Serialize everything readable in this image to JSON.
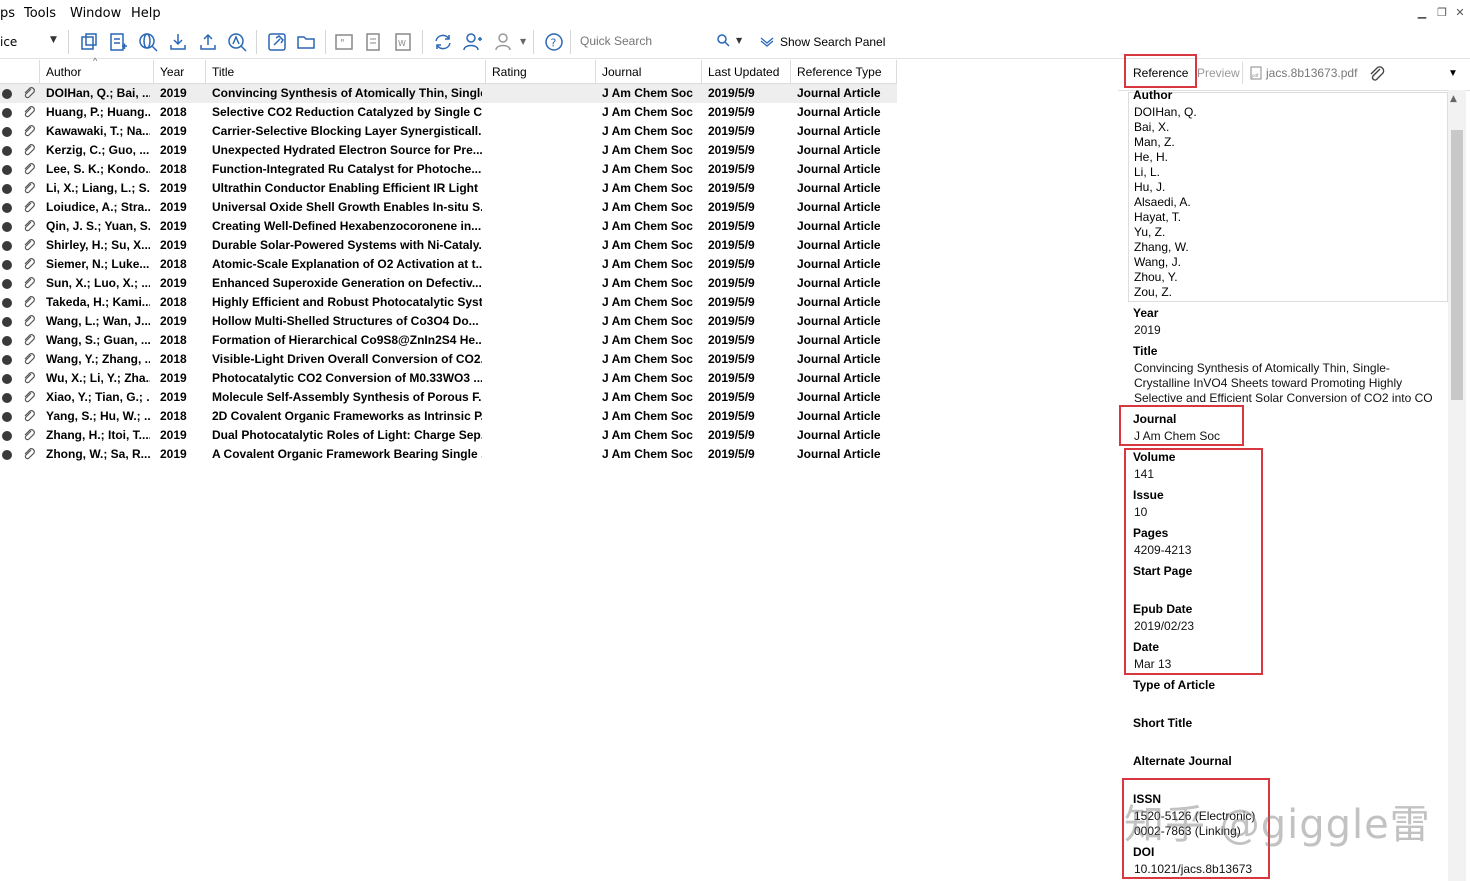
{
  "menu": {
    "partial": "ps",
    "tools": "Tools",
    "window": "Window",
    "help": "Help"
  },
  "toolbar": {
    "group_combo": "ice",
    "quick_search_placeholder": "Quick Search",
    "show_search_panel": "Show Search Panel"
  },
  "table": {
    "headers": [
      "Author",
      "Year",
      "Title",
      "Rating",
      "Journal",
      "Last Updated",
      "Reference Type"
    ],
    "rows": [
      {
        "author": "DOIHan, Q.; Bai, ...",
        "year": "2019",
        "title": "Convincing Synthesis of Atomically Thin, Single...",
        "journal": "J Am Chem Soc",
        "updated": "2019/5/9",
        "type": "Journal Article"
      },
      {
        "author": "Huang, P.; Huang...",
        "year": "2018",
        "title": "Selective CO2 Reduction Catalyzed by Single C...",
        "journal": "J Am Chem Soc",
        "updated": "2019/5/9",
        "type": "Journal Article"
      },
      {
        "author": "Kawawaki, T.; Na...",
        "year": "2019",
        "title": "Carrier-Selective Blocking Layer Synergisticall...",
        "journal": "J Am Chem Soc",
        "updated": "2019/5/9",
        "type": "Journal Article"
      },
      {
        "author": "Kerzig, C.; Guo, ...",
        "year": "2019",
        "title": "Unexpected Hydrated Electron Source for Pre...",
        "journal": "J Am Chem Soc",
        "updated": "2019/5/9",
        "type": "Journal Article"
      },
      {
        "author": "Lee, S. K.; Kondo...",
        "year": "2018",
        "title": "Function-Integrated Ru Catalyst for Photoche...",
        "journal": "J Am Chem Soc",
        "updated": "2019/5/9",
        "type": "Journal Article"
      },
      {
        "author": "Li, X.; Liang, L.; S...",
        "year": "2019",
        "title": "Ultrathin Conductor Enabling Efficient IR Light ...",
        "journal": "J Am Chem Soc",
        "updated": "2019/5/9",
        "type": "Journal Article"
      },
      {
        "author": "Loiudice, A.; Stra...",
        "year": "2019",
        "title": "Universal Oxide Shell Growth Enables In-situ S...",
        "journal": "J Am Chem Soc",
        "updated": "2019/5/9",
        "type": "Journal Article"
      },
      {
        "author": "Qin, J. S.; Yuan, S...",
        "year": "2019",
        "title": "Creating Well-Defined Hexabenzocoronene in...",
        "journal": "J Am Chem Soc",
        "updated": "2019/5/9",
        "type": "Journal Article"
      },
      {
        "author": "Shirley, H.; Su, X....",
        "year": "2019",
        "title": "Durable Solar-Powered Systems with Ni-Cataly...",
        "journal": "J Am Chem Soc",
        "updated": "2019/5/9",
        "type": "Journal Article"
      },
      {
        "author": "Siemer, N.; Luke...",
        "year": "2018",
        "title": "Atomic-Scale Explanation of O2 Activation at t...",
        "journal": "J Am Chem Soc",
        "updated": "2019/5/9",
        "type": "Journal Article"
      },
      {
        "author": "Sun, X.; Luo, X.; ...",
        "year": "2019",
        "title": "Enhanced Superoxide Generation on Defectiv...",
        "journal": "J Am Chem Soc",
        "updated": "2019/5/9",
        "type": "Journal Article"
      },
      {
        "author": "Takeda, H.; Kami...",
        "year": "2018",
        "title": "Highly Efficient and Robust Photocatalytic Syst...",
        "journal": "J Am Chem Soc",
        "updated": "2019/5/9",
        "type": "Journal Article"
      },
      {
        "author": "Wang, L.; Wan, J....",
        "year": "2019",
        "title": "Hollow Multi-Shelled Structures of Co3O4 Do...",
        "journal": "J Am Chem Soc",
        "updated": "2019/5/9",
        "type": "Journal Article"
      },
      {
        "author": "Wang, S.; Guan, ...",
        "year": "2018",
        "title": "Formation of Hierarchical Co9S8@ZnIn2S4 He...",
        "journal": "J Am Chem Soc",
        "updated": "2019/5/9",
        "type": "Journal Article"
      },
      {
        "author": "Wang, Y.; Zhang, ...",
        "year": "2018",
        "title": "Visible-Light Driven Overall Conversion of CO2...",
        "journal": "J Am Chem Soc",
        "updated": "2019/5/9",
        "type": "Journal Article"
      },
      {
        "author": "Wu, X.; Li, Y.; Zha...",
        "year": "2019",
        "title": "Photocatalytic CO2 Conversion of M0.33WO3 ...",
        "journal": "J Am Chem Soc",
        "updated": "2019/5/9",
        "type": "Journal Article"
      },
      {
        "author": "Xiao, Y.; Tian, G.; ...",
        "year": "2019",
        "title": "Molecule Self-Assembly Synthesis of Porous F...",
        "journal": "J Am Chem Soc",
        "updated": "2019/5/9",
        "type": "Journal Article"
      },
      {
        "author": "Yang, S.; Hu, W.; ...",
        "year": "2018",
        "title": "2D Covalent Organic Frameworks as Intrinsic P...",
        "journal": "J Am Chem Soc",
        "updated": "2019/5/9",
        "type": "Journal Article"
      },
      {
        "author": "Zhang, H.; Itoi, T....",
        "year": "2019",
        "title": "Dual Photocatalytic Roles of Light: Charge Sep...",
        "journal": "J Am Chem Soc",
        "updated": "2019/5/9",
        "type": "Journal Article"
      },
      {
        "author": "Zhong, W.; Sa, R....",
        "year": "2019",
        "title": "A Covalent Organic Framework Bearing Single ...",
        "journal": "J Am Chem Soc",
        "updated": "2019/5/9",
        "type": "Journal Article"
      }
    ]
  },
  "panel": {
    "tabs": {
      "reference": "Reference",
      "preview": "Preview",
      "pdf": "jacs.8b13673.pdf"
    },
    "author_label": "Author",
    "authors": [
      "DOIHan, Q.",
      "Bai, X.",
      "Man, Z.",
      "He, H.",
      "Li, L.",
      "Hu, J.",
      "Alsaedi, A.",
      "Hayat, T.",
      "Yu, Z.",
      "Zhang, W.",
      "Wang, J.",
      "Zhou, Y.",
      "Zou, Z."
    ],
    "year_label": "Year",
    "year": "2019",
    "title_label": "Title",
    "title_lines": [
      "Convincing Synthesis of Atomically Thin, Single-",
      "Crystalline InVO4 Sheets toward Promoting Highly",
      "Selective and Efficient Solar Conversion of CO2 into CO"
    ],
    "journal_label": "Journal",
    "journal": "J Am Chem Soc",
    "volume_label": "Volume",
    "volume": "141",
    "issue_label": "Issue",
    "issue": "10",
    "pages_label": "Pages",
    "pages": "4209-4213",
    "start_page_label": "Start Page",
    "epub_label": "Epub Date",
    "epub": "2019/02/23",
    "date_label": "Date",
    "date": "Mar 13",
    "type_label": "Type of Article",
    "short_title_label": "Short Title",
    "alt_journal_label": "Alternate Journal",
    "issn_label": "ISSN",
    "issn_lines": [
      "1520-5126 (Electronic)",
      "0002-7863 (Linking)"
    ],
    "doi_label": "DOI",
    "doi": "10.1021/jacs.8b13673"
  },
  "watermark": "知乎 @giggle雷",
  "colors": {
    "highlight_box": "#d9373f",
    "icon_blue": "#2a67b6"
  }
}
